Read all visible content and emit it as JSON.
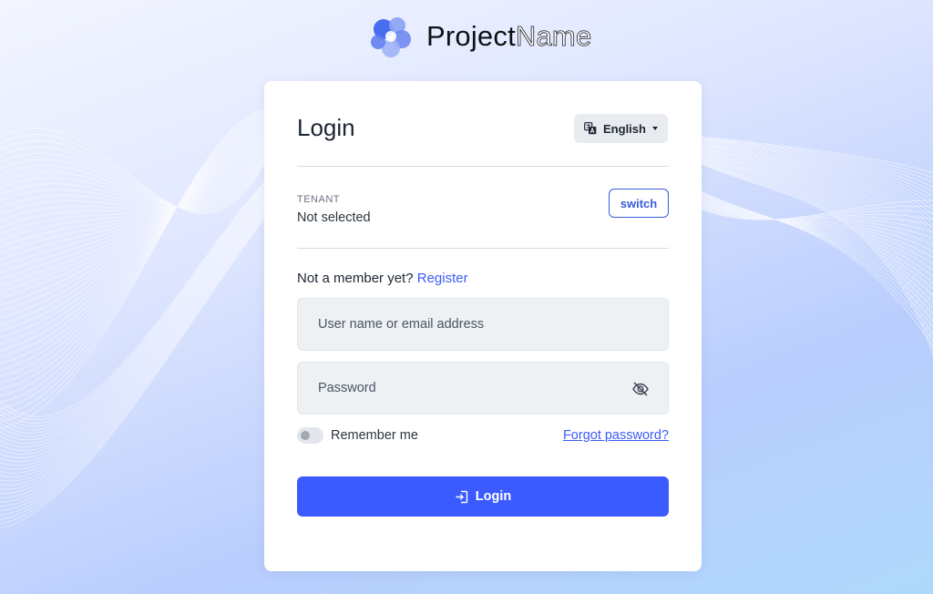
{
  "brand": {
    "name_part1": "Project",
    "name_part2": "Name",
    "icon": "flower-logo-icon",
    "accent_color": "#3b5bff"
  },
  "card": {
    "title": "Login",
    "language": {
      "label": "English",
      "icon": "translate-icon"
    },
    "tenant": {
      "label": "TENANT",
      "value": "Not selected",
      "switch_label": "switch"
    },
    "register": {
      "prompt": "Not a member yet?",
      "link_label": "Register"
    },
    "username_field": {
      "placeholder": "User name or email address",
      "value": ""
    },
    "password_field": {
      "placeholder": "Password",
      "value": "",
      "toggle_icon": "eye-slash-icon"
    },
    "remember_me": {
      "label": "Remember me",
      "checked": false
    },
    "forgot_password_label": "Forgot password?",
    "login_button": {
      "label": "Login",
      "icon": "login-icon"
    }
  }
}
